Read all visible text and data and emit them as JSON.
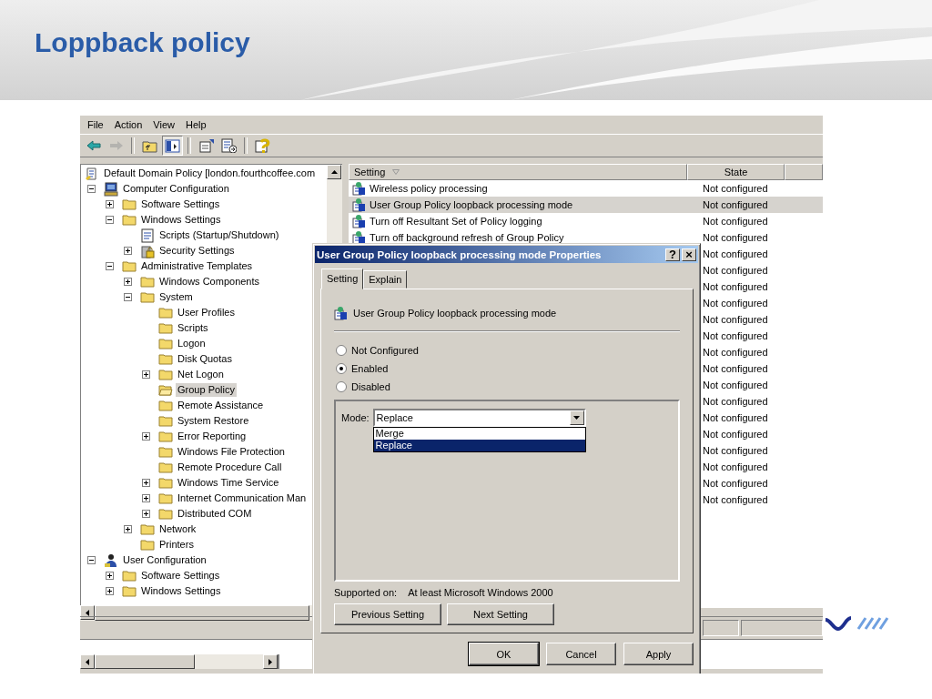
{
  "slide": {
    "title": "Loppback policy"
  },
  "menu": [
    {
      "label": "File"
    },
    {
      "label": "Action"
    },
    {
      "label": "View"
    },
    {
      "label": "Help"
    }
  ],
  "toolbar": [
    {
      "kind": "back",
      "disabled": false,
      "pressed": false
    },
    {
      "kind": "forward",
      "disabled": true,
      "pressed": false
    },
    {
      "kind": "separator"
    },
    {
      "kind": "up",
      "disabled": false,
      "pressed": false
    },
    {
      "kind": "tree",
      "disabled": false,
      "pressed": true
    },
    {
      "kind": "separator"
    },
    {
      "kind": "properties",
      "disabled": false,
      "pressed": false
    },
    {
      "kind": "export",
      "disabled": false,
      "pressed": false
    },
    {
      "kind": "separator"
    },
    {
      "kind": "help",
      "disabled": false,
      "pressed": false
    }
  ],
  "tree": {
    "label": "Default Domain Policy [london.fourthcoffee.com",
    "kind": "policy",
    "selected": false,
    "children": [
      {
        "label": "Computer Configuration",
        "kind": "computer",
        "expanded": true,
        "selected": false,
        "children": [
          {
            "label": "Software Settings",
            "kind": "folder",
            "expanded": false,
            "selected": false
          },
          {
            "label": "Windows Settings",
            "kind": "folder",
            "expanded": true,
            "selected": false,
            "children": [
              {
                "label": "Scripts (Startup/Shutdown)",
                "kind": "script",
                "selected": false
              },
              {
                "label": "Security Settings",
                "kind": "security",
                "expanded": false,
                "selected": false
              }
            ]
          },
          {
            "label": "Administrative Templates",
            "kind": "folder",
            "expanded": true,
            "selected": false,
            "children": [
              {
                "label": "Windows Components",
                "kind": "folder",
                "expanded": false,
                "selected": false
              },
              {
                "label": "System",
                "kind": "folder",
                "expanded": true,
                "selected": false,
                "children": [
                  {
                    "label": "User Profiles",
                    "kind": "folder",
                    "selected": false
                  },
                  {
                    "label": "Scripts",
                    "kind": "folder",
                    "selected": false
                  },
                  {
                    "label": "Logon",
                    "kind": "folder",
                    "selected": false
                  },
                  {
                    "label": "Disk Quotas",
                    "kind": "folder",
                    "selected": false
                  },
                  {
                    "label": "Net Logon",
                    "kind": "folder",
                    "expanded": false,
                    "selected": false
                  },
                  {
                    "label": "Group Policy",
                    "kind": "open-folder",
                    "selected": true
                  },
                  {
                    "label": "Remote Assistance",
                    "kind": "folder",
                    "selected": false
                  },
                  {
                    "label": "System Restore",
                    "kind": "folder",
                    "selected": false
                  },
                  {
                    "label": "Error Reporting",
                    "kind": "folder",
                    "expanded": false,
                    "selected": false
                  },
                  {
                    "label": "Windows File Protection",
                    "kind": "folder",
                    "selected": false
                  },
                  {
                    "label": "Remote Procedure Call",
                    "kind": "folder",
                    "selected": false
                  },
                  {
                    "label": "Windows Time Service",
                    "kind": "folder",
                    "expanded": false,
                    "selected": false
                  },
                  {
                    "label": "Internet Communication Man",
                    "kind": "folder",
                    "expanded": false,
                    "selected": false
                  },
                  {
                    "label": "Distributed COM",
                    "kind": "folder",
                    "expanded": false,
                    "selected": false
                  }
                ]
              },
              {
                "label": "Network",
                "kind": "folder",
                "expanded": false,
                "selected": false
              },
              {
                "label": "Printers",
                "kind": "folder",
                "selected": false
              }
            ]
          }
        ]
      },
      {
        "label": "User Configuration",
        "kind": "user",
        "expanded": true,
        "selected": false,
        "children": [
          {
            "label": "Software Settings",
            "kind": "folder",
            "expanded": false,
            "selected": false
          },
          {
            "label": "Windows Settings",
            "kind": "folder",
            "expanded": false,
            "selected": false
          }
        ]
      }
    ]
  },
  "list": {
    "columns": [
      {
        "label": "Setting",
        "sorted": true
      },
      {
        "label": "State",
        "sorted": false
      }
    ],
    "rows": [
      {
        "setting": "Wireless policy processing",
        "state": "Not configured",
        "selected": false
      },
      {
        "setting": "User Group Policy loopback processing mode",
        "state": "Not configured",
        "selected": true
      },
      {
        "setting": "Turn off Resultant Set of Policy logging",
        "state": "Not configured",
        "selected": false
      },
      {
        "setting": "Turn off background refresh of Group Policy",
        "state": "Not configured",
        "selected": false
      },
      {
        "state": "Not configured",
        "selected": false
      },
      {
        "state": "Not configured",
        "selected": false
      },
      {
        "state": "Not configured",
        "selected": false
      },
      {
        "state": "Not configured",
        "selected": false
      },
      {
        "state": "Not configured",
        "selected": false
      },
      {
        "state": "Not configured",
        "selected": false
      },
      {
        "state": "Not configured",
        "selected": false
      },
      {
        "state": "Not configured",
        "selected": false
      },
      {
        "state": "Not configured",
        "selected": false
      },
      {
        "state": "Not configured",
        "selected": false
      },
      {
        "state": "Not configured",
        "selected": false
      },
      {
        "state": "Not configured",
        "selected": false
      },
      {
        "state": "Not configured",
        "selected": false
      },
      {
        "state": "Not configured",
        "selected": false
      },
      {
        "state": "Not configured",
        "selected": false
      },
      {
        "state": "Not configured",
        "selected": false
      }
    ]
  },
  "dialog": {
    "title": "User Group Policy loopback processing mode Properties",
    "help_button": "?",
    "close_button": "×",
    "tabs": [
      {
        "label": "Setting",
        "selected": true
      },
      {
        "label": "Explain",
        "selected": false
      }
    ],
    "policy_title": "User Group Policy loopback processing mode",
    "options": [
      {
        "label": "Not Configured",
        "selected": false
      },
      {
        "label": "Enabled",
        "selected": true
      },
      {
        "label": "Disabled",
        "selected": false
      }
    ],
    "mode": {
      "label": "Mode:",
      "value": "Replace",
      "open": true,
      "options": [
        {
          "label": "Merge",
          "selected": false
        },
        {
          "label": "Replace",
          "selected": true
        }
      ]
    },
    "supported": {
      "label": "Supported on:",
      "value": "At least Microsoft Windows 2000"
    },
    "nav_buttons": [
      {
        "label": "Previous Setting"
      },
      {
        "label": "Next Setting"
      }
    ],
    "buttons": [
      {
        "label": "OK",
        "default": true
      },
      {
        "label": "Cancel",
        "default": false
      },
      {
        "label": "Apply",
        "default": false
      }
    ]
  }
}
